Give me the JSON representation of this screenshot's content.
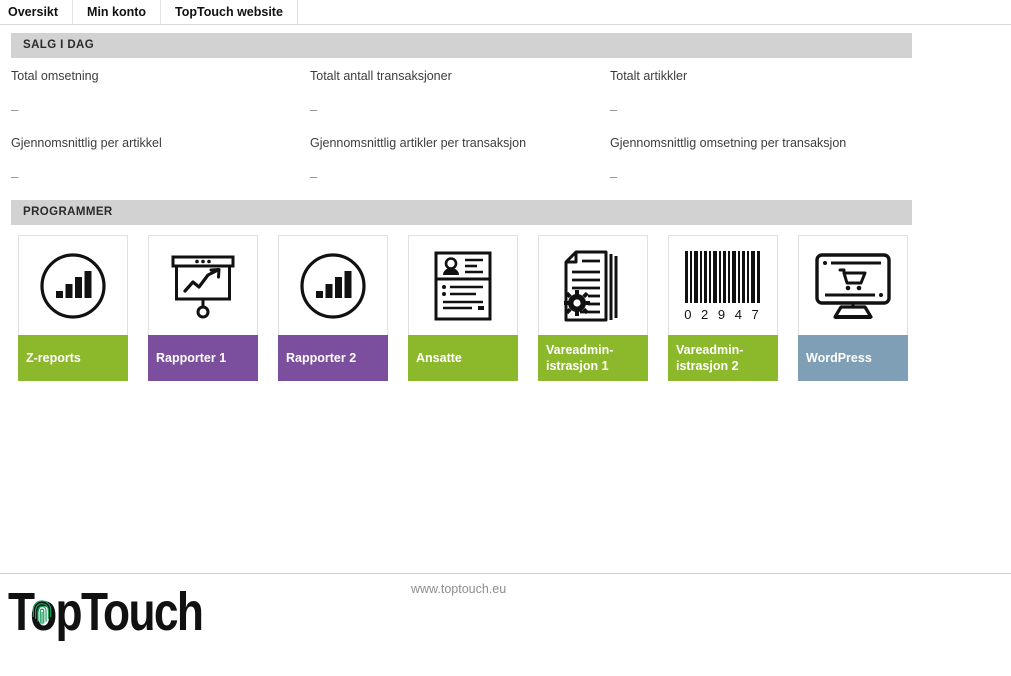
{
  "tabs": [
    {
      "label": "Oversikt",
      "active": true
    },
    {
      "label": "Min konto",
      "active": false
    },
    {
      "label": "TopTouch website",
      "active": false
    }
  ],
  "sales_section": {
    "header": "SALG I DAG",
    "metrics": [
      {
        "label": "Total omsetning",
        "value": "–"
      },
      {
        "label": "Totalt antall transaksjoner",
        "value": "–"
      },
      {
        "label": "Totalt artikkler",
        "value": "–"
      },
      {
        "label": "Gjennomsnittlig per artikkel",
        "value": "–"
      },
      {
        "label": "Gjennomsnittlig artikler per transaksjon",
        "value": "–"
      },
      {
        "label": "Gjennomsnittlig omsetning per transaksjon",
        "value": "–"
      }
    ]
  },
  "programs_section": {
    "header": "PROGRAMMER",
    "tiles": [
      {
        "label": "Z-reports",
        "icon": "circle-bar-chart-icon",
        "color": "#8cb82b"
      },
      {
        "label": "Rapporter 1",
        "icon": "presentation-chart-icon",
        "color": "#7c4f9e"
      },
      {
        "label": "Rapporter 2",
        "icon": "circle-bar-chart-icon",
        "color": "#7c4f9e"
      },
      {
        "label": "Ansatte",
        "icon": "id-card-icon",
        "color": "#8cb82b"
      },
      {
        "label": "Vareadmin-istrasjon 1",
        "icon": "document-gear-icon",
        "color": "#8cb82b"
      },
      {
        "label": "Vareadmin-istrasjon 2",
        "icon": "barcode-icon",
        "color": "#8cb82b"
      },
      {
        "label": "WordPress",
        "icon": "monitor-cart-icon",
        "color": "#7e9fb5"
      }
    ],
    "barcode_digits": "0 2 9 4 7"
  },
  "footer": {
    "url": "www.toptouch.eu",
    "logo_top": "T",
    "logo_rest": "pTouch",
    "logo_full": "TopTouch",
    "fingerprint_color": "#1a9e5e"
  }
}
